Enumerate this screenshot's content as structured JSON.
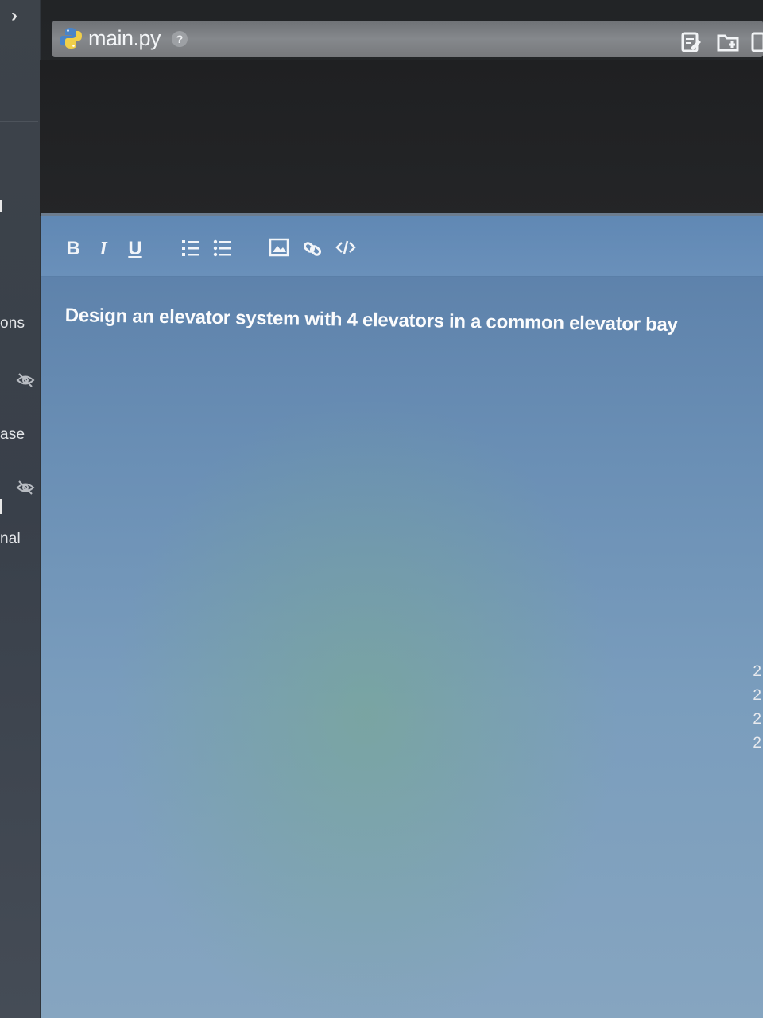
{
  "sidebar": {
    "chevron": "›",
    "items": [
      {
        "label": "ons"
      },
      {
        "label": "ase"
      },
      {
        "label": "nal"
      }
    ],
    "icons": [
      "eye-off-icon",
      "eye-off-icon"
    ]
  },
  "tab": {
    "filename": "main.py",
    "help": "?",
    "icons": [
      "python-icon",
      "edit-file-icon",
      "new-folder-icon",
      "file-icon"
    ]
  },
  "editor": {
    "toolbar": {
      "bold": "B",
      "italic": "I",
      "underline": "U",
      "icons": [
        "ordered-list-icon",
        "unordered-list-icon",
        "image-icon",
        "link-icon",
        "code-icon"
      ]
    },
    "content": "Design an elevator system with 4 elevators in a common elevator bay"
  },
  "gutter": {
    "numbers": [
      "2",
      "2",
      "2",
      "2"
    ]
  },
  "colors": {
    "editor_bg": "#6a8fb5",
    "tab_bg": "#7a7d80",
    "sidebar_bg": "#3d434a"
  }
}
